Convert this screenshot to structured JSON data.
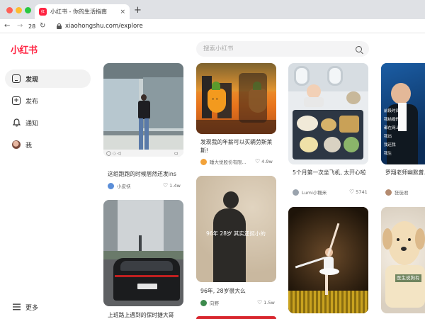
{
  "browser": {
    "tab_title": "小红书 - 你的生活指南",
    "tab_favicon_text": "小红书",
    "tab_close": "×",
    "new_tab": "+",
    "back": "←",
    "forward": "→",
    "history_count": "28",
    "reload": "C",
    "url": "xiaohongshu.com/explore"
  },
  "app": {
    "logo": "小红书",
    "search": {
      "placeholder": "搜索小红书"
    }
  },
  "sidebar": {
    "items": [
      {
        "label": "发现",
        "icon": "home-icon",
        "active": true
      },
      {
        "label": "发布",
        "icon": "plus-square-icon"
      },
      {
        "label": "通知",
        "icon": "bell-icon"
      },
      {
        "label": "我",
        "icon": "avatar"
      }
    ],
    "more": {
      "label": "更多",
      "icon": "menu-icon"
    }
  },
  "feed": [
    {
      "title": "这组跑跑的时候居然还发ins",
      "author": "小皮袄",
      "likes": "1.4w"
    },
    {
      "title": "上班路上遇到的保时捷大哥",
      "author": "",
      "likes": ""
    },
    {
      "title": "发现我的年薪可以买辆劳斯莱斯!",
      "author": "睡大觉股份有限...",
      "likes": "4.9w",
      "image_caption": ""
    },
    {
      "title": "96年, 28岁很大么",
      "author": "向野",
      "likes": "1.5w",
      "image_caption": "96年 28岁 其实还挺小的"
    },
    {
      "title": "5个月第一次坐飞机, 太开心啦",
      "author": "Lumi小糯米",
      "likes": "5741"
    },
    {
      "title": "",
      "author": "",
      "likes": ""
    },
    {
      "title": "罗翔老师幽默普...我结婚啦",
      "author": "狂徒君",
      "likes": ""
    },
    {
      "title": "",
      "author": "",
      "likes": "",
      "image_caption": "医生说狗有"
    }
  ],
  "colors": {
    "brand": "#ff2442",
    "active_bg": "#f2f2f2"
  }
}
